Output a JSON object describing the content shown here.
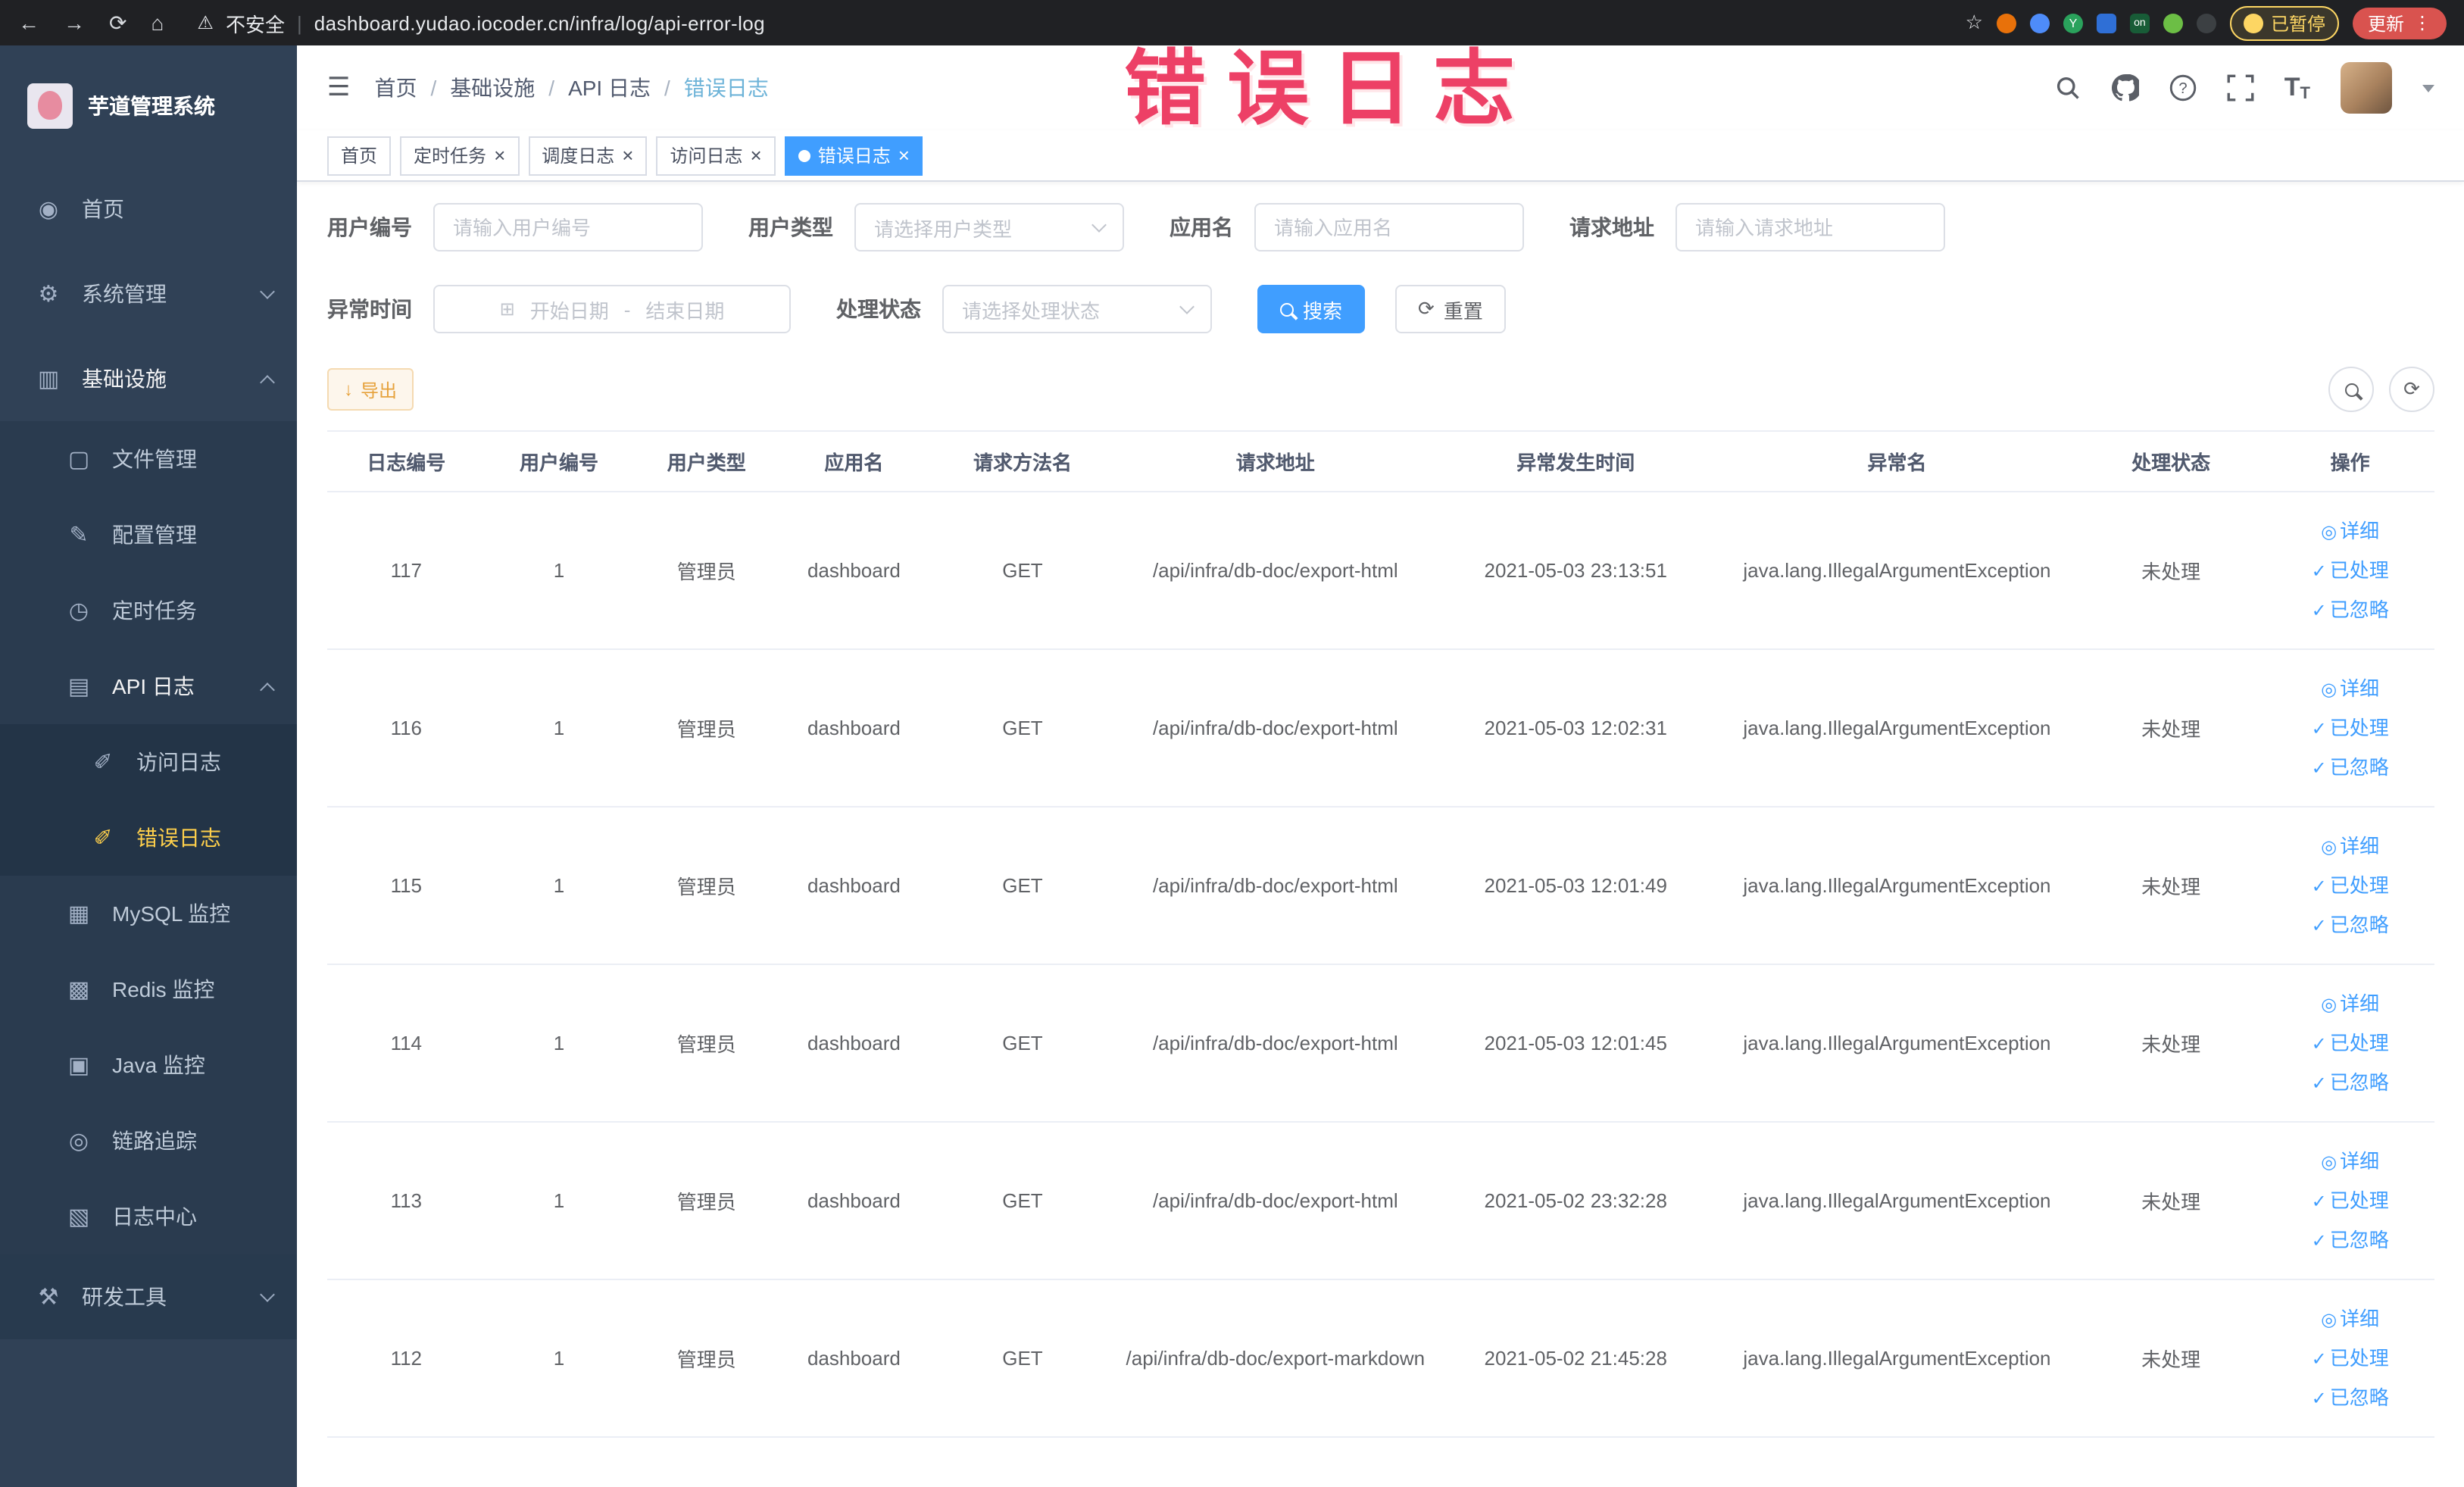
{
  "colors": {
    "primary": "#409eff",
    "warning": "#e6a23c",
    "sidebar_bg": "#304156",
    "sidebar_active_text": "#ffd04b",
    "annotation_red": "#ed4066",
    "chrome_bg": "#202124"
  },
  "icons": {
    "back": "←",
    "forward": "→",
    "reload": "⟳",
    "home": "⌂",
    "warning": "⚠",
    "divider": "|",
    "star": "☆",
    "menu_dots": "⋮",
    "hamburger": "☰",
    "dashboard": "◉",
    "gear": "⚙",
    "infra": "▥",
    "file": "▢",
    "config": "✎",
    "timer": "◷",
    "api": "▤",
    "doc": "✐",
    "mysql": "▦",
    "redis": "▩",
    "java": "▣",
    "trace": "◎",
    "logcenter": "▧",
    "tools": "⚒",
    "close": "×",
    "calendar": "⊞",
    "refresh": "⟳",
    "download": "↓",
    "eye": "◎",
    "check": "✓",
    "question": "?",
    "letter_t": "T",
    "ext_y": "Y"
  },
  "annotation": "错误日志",
  "browser": {
    "security_label": "不安全",
    "url": "dashboard.yudao.iocoder.cn/infra/log/api-error-log",
    "ext_on_badge": "on",
    "profile_chip": "已暂停",
    "update_button": "更新"
  },
  "sidebar": {
    "logo_title": "芋道管理系统",
    "items": [
      {
        "label": "首页"
      },
      {
        "label": "系统管理"
      },
      {
        "label": "基础设施"
      },
      {
        "label": "文件管理"
      },
      {
        "label": "配置管理"
      },
      {
        "label": "定时任务"
      },
      {
        "label": "API 日志"
      },
      {
        "label": "访问日志"
      },
      {
        "label": "错误日志"
      },
      {
        "label": "MySQL 监控"
      },
      {
        "label": "Redis 监控"
      },
      {
        "label": "Java 监控"
      },
      {
        "label": "链路追踪"
      },
      {
        "label": "日志中心"
      },
      {
        "label": "研发工具"
      }
    ]
  },
  "breadcrumb": {
    "separator": "/",
    "items": [
      "首页",
      "基础设施",
      "API 日志",
      "错误日志"
    ]
  },
  "tabs": [
    {
      "label": "首页"
    },
    {
      "label": "定时任务"
    },
    {
      "label": "调度日志"
    },
    {
      "label": "访问日志"
    },
    {
      "label": "错误日志"
    }
  ],
  "filters": {
    "user_id_label": "用户编号",
    "user_id_placeholder": "请输入用户编号",
    "user_type_label": "用户类型",
    "user_type_placeholder": "请选择用户类型",
    "app_name_label": "应用名",
    "app_name_placeholder": "请输入应用名",
    "request_url_label": "请求地址",
    "request_url_placeholder": "请输入请求地址",
    "time_label": "异常时间",
    "time_start_placeholder": "开始日期",
    "time_separator": "-",
    "time_end_placeholder": "结束日期",
    "status_label": "处理状态",
    "status_placeholder": "请选择处理状态",
    "search_button": "搜索",
    "reset_button": "重置"
  },
  "toolbar": {
    "export_button": "导出"
  },
  "table": {
    "columns": [
      "日志编号",
      "用户编号",
      "用户类型",
      "应用名",
      "请求方法名",
      "请求地址",
      "异常发生时间",
      "异常名",
      "处理状态",
      "操作"
    ],
    "action_labels": {
      "detail": "详细",
      "processed": "已处理",
      "ignored": "已忽略"
    },
    "rows": [
      {
        "id": "117",
        "user_id": "1",
        "user_type": "管理员",
        "app_name": "dashboard",
        "method": "GET",
        "url": "/api/infra/db-doc/export-html",
        "time": "2021-05-03 23:13:51",
        "exception": "java.lang.IllegalArgumentException",
        "status": "未处理"
      },
      {
        "id": "116",
        "user_id": "1",
        "user_type": "管理员",
        "app_name": "dashboard",
        "method": "GET",
        "url": "/api/infra/db-doc/export-html",
        "time": "2021-05-03 12:02:31",
        "exception": "java.lang.IllegalArgumentException",
        "status": "未处理"
      },
      {
        "id": "115",
        "user_id": "1",
        "user_type": "管理员",
        "app_name": "dashboard",
        "method": "GET",
        "url": "/api/infra/db-doc/export-html",
        "time": "2021-05-03 12:01:49",
        "exception": "java.lang.IllegalArgumentException",
        "status": "未处理"
      },
      {
        "id": "114",
        "user_id": "1",
        "user_type": "管理员",
        "app_name": "dashboard",
        "method": "GET",
        "url": "/api/infra/db-doc/export-html",
        "time": "2021-05-03 12:01:45",
        "exception": "java.lang.IllegalArgumentException",
        "status": "未处理"
      },
      {
        "id": "113",
        "user_id": "1",
        "user_type": "管理员",
        "app_name": "dashboard",
        "method": "GET",
        "url": "/api/infra/db-doc/export-html",
        "time": "2021-05-02 23:32:28",
        "exception": "java.lang.IllegalArgumentException",
        "status": "未处理"
      },
      {
        "id": "112",
        "user_id": "1",
        "user_type": "管理员",
        "app_name": "dashboard",
        "method": "GET",
        "url": "/api/infra/db-doc/export-markdown",
        "time": "2021-05-02 21:45:28",
        "exception": "java.lang.IllegalArgumentException",
        "status": "未处理"
      }
    ]
  }
}
